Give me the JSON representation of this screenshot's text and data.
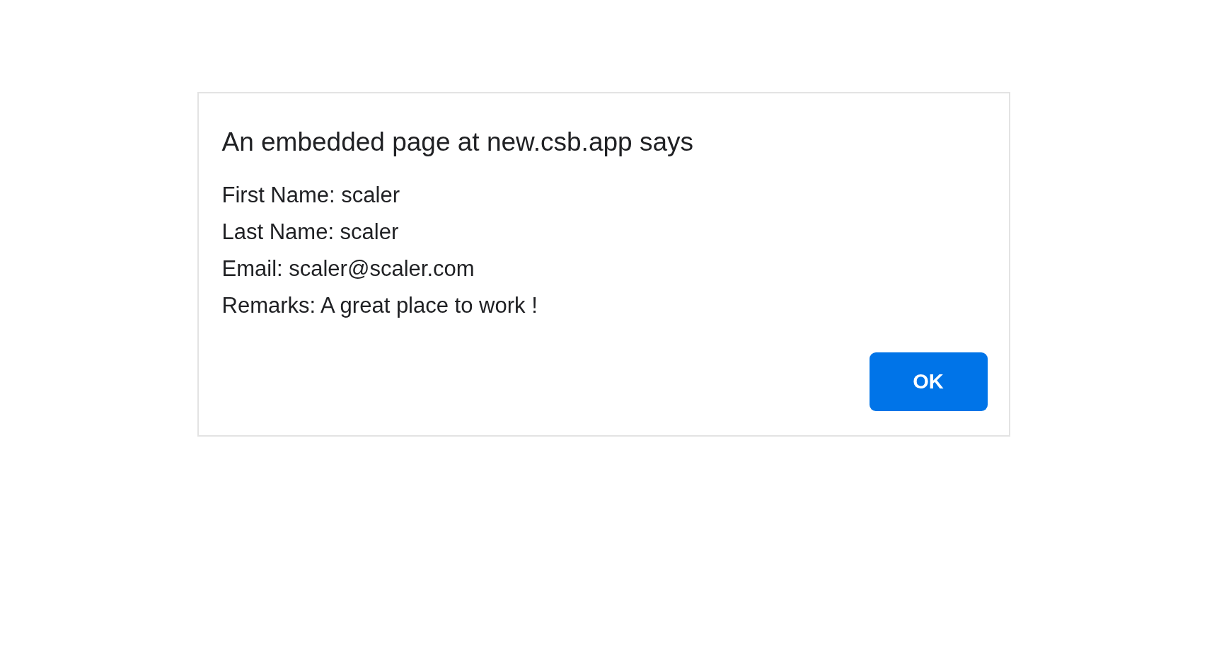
{
  "dialog": {
    "title": "An embedded page at new.csb.app says",
    "message_lines": [
      "First Name: scaler",
      "Last Name: scaler",
      "Email: scaler@scaler.com",
      "Remarks: A great place to work !"
    ],
    "buttons": [
      "OK"
    ]
  }
}
